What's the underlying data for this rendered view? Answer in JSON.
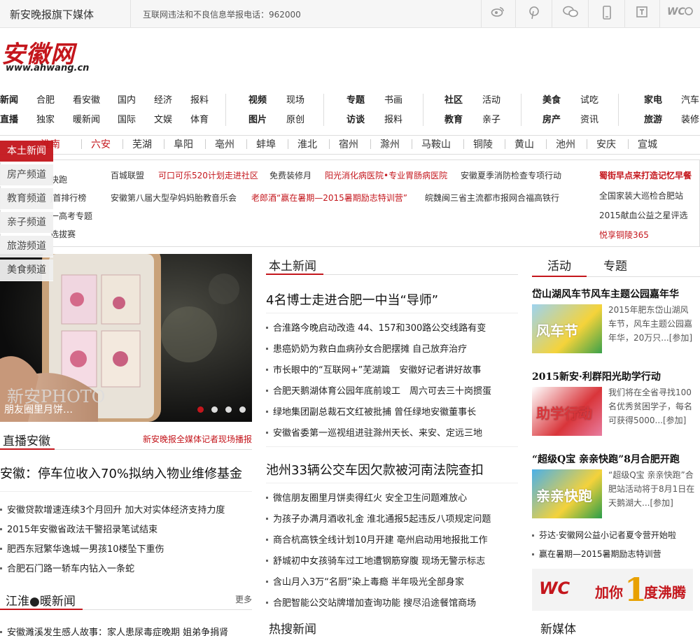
{
  "topbar": {
    "brand": "新安晚报旗下媒体",
    "report": "互联网违法和不良信息举报电话：962000",
    "icons": [
      "weibo-icon",
      "pinterest-icon",
      "wechat-icon",
      "mobile-icon",
      "reader-icon",
      "ahwang-icon"
    ]
  },
  "logo": {
    "cn": "安徽网",
    "en": "www.ahwang.cn"
  },
  "nav": {
    "row1": [
      "新闻",
      "合肥",
      "看安徽",
      "国内",
      "经济",
      "报料",
      "视频",
      "现场",
      "专题",
      "书画",
      "社区",
      "活动",
      "美食",
      "试吃",
      "家电",
      "汽车"
    ],
    "row2": [
      "直播",
      "独家",
      "暖新闻",
      "国际",
      "文娱",
      "体育",
      "图片",
      "原创",
      "访谈",
      "报料",
      "教育",
      "亲子",
      "房产",
      "资讯",
      "旅游",
      "装修"
    ]
  },
  "cities": [
    "淮南",
    "六安",
    "芜湖",
    "阜阳",
    "亳州",
    "蚌埠",
    "淮北",
    "宿州",
    "滁州",
    "马鞍山",
    "铜陵",
    "黄山",
    "池州",
    "安庆",
    "宣城"
  ],
  "sidetabs": [
    "本土新闻",
    "房产频道",
    "教育频道",
    "亲子频道",
    "旅游频道",
    "美食频道"
  ],
  "links": {
    "col0": [
      "快跑",
      "j首排行榜",
      "一高考专题",
      "选拔赛"
    ],
    "row1": [
      "百城联盟",
      "可口可乐520计划走进社区",
      "免费装修月",
      "阳光消化病医院•专业胃肠病医院",
      "安徽夏季消防检查专项行动"
    ],
    "row2": [
      "安徽第八届大型孕妈妈胎教音乐会",
      "老郎酒“赢在暑期—2015暑期励志特训营”",
      "皖魏闽三省主流都市报网合福高铁行"
    ],
    "right": [
      "蜀街早点来打造记忆早餐",
      "全国家装大巡检合肥站",
      "2015献血公益之星评选",
      "悦享铜陵365"
    ]
  },
  "photo": {
    "caption": "朋友圈里月饼…",
    "watermark": "新安PHOTO"
  },
  "zhibo": {
    "title": "直播安徽",
    "more": "新安晚报全媒体记者现场播报",
    "headline": "安徽：停车位收入70%拟纳入物业维修基金",
    "items": [
      "安徽贷款增速连续3个月回升 加大对实体经济支持力度",
      "2015年安徽省政法干警招录笔试结束",
      "肥西东冠繁华逸城一男孩10楼坠下重伤",
      "合肥石门路一轿车内钻入一条蛇"
    ]
  },
  "jianghuai": {
    "title": "江淮●暖新闻",
    "more": "更多",
    "items": [
      "安徽濉溪发生感人故事：家人患尿毒症晚期 姐弟争捐肾"
    ]
  },
  "bentu": {
    "title": "本土新闻",
    "headline1": "4名博士走进合肥一中当“导师”",
    "list1": [
      "合淮路今晚启动改造 44、157和300路公交线路有变",
      "患癌奶奶为救白血病孙女合肥摆摊 自己放弃治疗",
      "市长眼中的“互联网+”芜湖篇　安徽好记者讲好故事",
      "合肥天鹅湖体育公园年底前竣工　周六可去三十岗掼蛋",
      "绿地集团副总裁石文红被批捕 曾任绿地安徽董事长",
      "安徽省委第一巡视组进驻滁州天长、来安、定远三地"
    ],
    "headline2": "池州33辆公交车因欠款被河南法院查扣",
    "list2": [
      "微信朋友圈里月饼卖得红火 安全卫生问题难放心",
      "为孩子办满月酒收礼金 淮北通报5起违反八项规定问题",
      "商合杭高铁全线计划10月开建 亳州启动用地报批工作",
      "舒城初中女孩骑车过工地遭钢筋穿腹 现场无警示标志",
      "含山月入3万“名厨”染上毒瘾 半年吸光全部身家",
      "合肥智能公交站牌增加查询功能 搜尽沿途餐馆商场"
    ],
    "hot": "热搜新闻"
  },
  "activity": {
    "tabs": [
      "活动",
      "专题"
    ],
    "items": [
      {
        "title": "岱山湖风车节风车主题公园嘉年华",
        "desc": "2015年肥东岱山湖风车节，风车主题公园嘉年华，20万只...",
        "more": "[参加]",
        "thumb_text": "风车节"
      },
      {
        "title": "2015新安·利群阳光助学行动",
        "desc": "我们将在全省寻找100名优秀贫困学子，每名可获得5000...",
        "more": "[参加]",
        "thumb_text": "助学行动"
      },
      {
        "title": "“超级Q宝 亲亲快跑”8月合肥开跑",
        "desc": "“超级Q宝 亲亲快跑”合肥站活动将于8月1日在天鹅湖大...",
        "more": "[参加]",
        "thumb_text": "亲亲快跑"
      }
    ],
    "extra": [
      "芬达·安徽网公益小记者夏令营开始啦",
      "赢在暑期—2015暑期励志特训营"
    ],
    "banner": {
      "logo": "WC",
      "text1": "加你",
      "num": "1",
      "text2": "度沸腾"
    },
    "newmedia": "新媒体"
  }
}
